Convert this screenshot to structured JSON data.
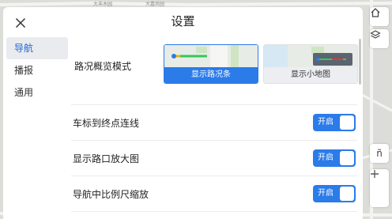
{
  "dialog": {
    "title": "设置"
  },
  "sidebar": {
    "items": [
      {
        "label": "导航",
        "active": true
      },
      {
        "label": "播报",
        "active": false
      },
      {
        "label": "通用",
        "active": false
      }
    ]
  },
  "settings": {
    "overview_mode": {
      "label": "路况概览模式",
      "options": [
        {
          "label": "显示路况条",
          "selected": true
        },
        {
          "label": "显示小地图",
          "selected": false
        }
      ]
    },
    "toggles": [
      {
        "label": "车标到终点连线",
        "state": "开启"
      },
      {
        "label": "显示路口放大图",
        "state": "开启"
      },
      {
        "label": "导航中比例尺缩放",
        "state": "开启"
      }
    ]
  },
  "map": {
    "labels": [
      "大丰木园",
      "大嘉尚园",
      "ñ"
    ]
  },
  "colors": {
    "accent": "#2b7be9",
    "active_text": "#1d64d6",
    "active_bg": "#e9ebee"
  }
}
